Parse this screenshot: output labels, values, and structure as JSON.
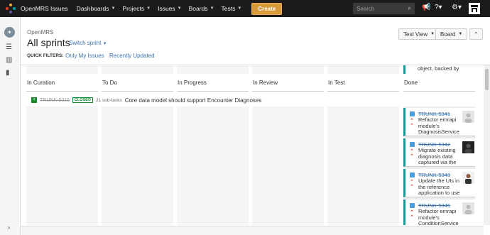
{
  "nav": {
    "brand": "OpenMRS Issues",
    "items": [
      {
        "label": "Dashboards"
      },
      {
        "label": "Projects"
      },
      {
        "label": "Issues"
      },
      {
        "label": "Boards"
      },
      {
        "label": "Tests"
      }
    ],
    "create_label": "Create",
    "search_placeholder": "Search"
  },
  "header": {
    "project": "OpenMRS",
    "title": "All sprints",
    "switch_label": "Switch sprint",
    "quick_filters_label": "QUICK FILTERS:",
    "quick_filters": [
      "Only My Issues",
      "Recently Updated"
    ],
    "test_view_label": "Test View",
    "board_label": "Board"
  },
  "columns": [
    "In Curation",
    "To Do",
    "In Progress",
    "In Review",
    "In Test",
    "Done"
  ],
  "top_card_text": "object, backed by",
  "swimlane": {
    "key": "TRUNK-5015",
    "status": "CLOSED",
    "subtasks": "21 sub-tasks",
    "summary": "Core data model should support Encounter Diagnoses"
  },
  "done_cards": [
    {
      "key": "TRUNK-5341",
      "summary": "Refactor emrapi module's DiagnosisService"
    },
    {
      "key": "TRUNK-5342",
      "summary": "Migrate existing diagnosis data captured via the"
    },
    {
      "key": "TRUNK-5343",
      "summary": "Update the UIs in the reference application to use"
    },
    {
      "key": "TRUNK-5345",
      "summary": "Refactor emrapi module's ConditionService"
    }
  ],
  "colors": {
    "topbar": "#1b1b1b",
    "create": "#d79a36",
    "link": "#3b73af",
    "done_border": "#1a9b95",
    "closed": "#14892c"
  }
}
